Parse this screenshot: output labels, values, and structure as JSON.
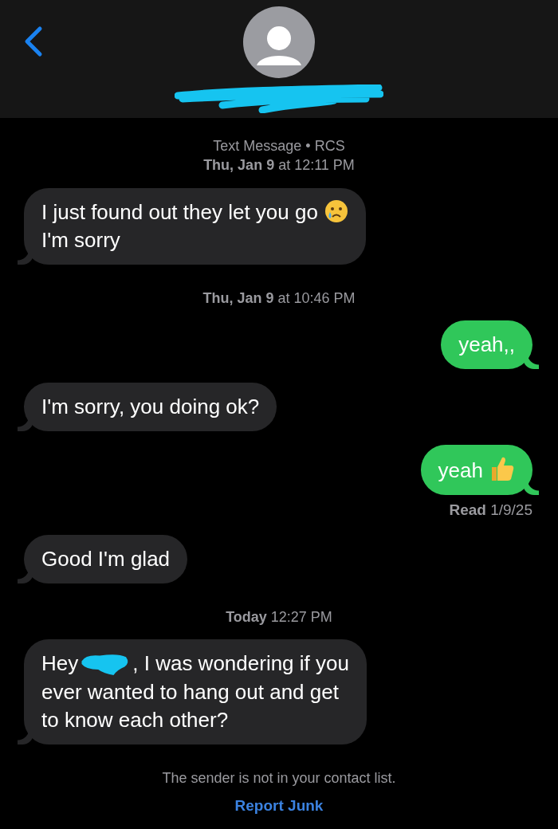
{
  "header": {
    "back": true,
    "contact_redacted": true
  },
  "thread": [
    {
      "kind": "meta",
      "service": "Text Message • RCS",
      "time": "**Thu, Jan 9** at 12:11 PM"
    },
    {
      "kind": "message",
      "outgoing": false,
      "parts": [
        {
          "kind": "text",
          "text": "I just found out they let you go"
        },
        {
          "kind": "crying-face"
        },
        {
          "kind": "linebreak"
        },
        {
          "kind": "text",
          "text": "I'm sorry"
        }
      ]
    },
    {
      "kind": "timestamp",
      "time": "**Thu, Jan 9** at 10:46 PM"
    },
    {
      "kind": "message",
      "outgoing": true,
      "parts": [
        {
          "kind": "text",
          "text": "yeah,,"
        }
      ]
    },
    {
      "kind": "message",
      "outgoing": false,
      "parts": [
        {
          "kind": "text",
          "text": "I'm sorry, you doing ok?"
        }
      ]
    },
    {
      "kind": "message",
      "outgoing": true,
      "parts": [
        {
          "kind": "text",
          "text": "yeah"
        },
        {
          "kind": "thumbs-up"
        }
      ]
    },
    {
      "kind": "receipt",
      "text": "**Read** 1/9/25"
    },
    {
      "kind": "message",
      "outgoing": false,
      "parts": [
        {
          "kind": "text",
          "text": "Good I'm glad"
        }
      ]
    },
    {
      "kind": "timestamp",
      "time": "**Today** 12:27 PM"
    },
    {
      "kind": "message",
      "outgoing": false,
      "parts": [
        {
          "kind": "text",
          "text": "Hey"
        },
        {
          "kind": "scribble"
        },
        {
          "kind": "text",
          "text": ", I was wondering if you"
        },
        {
          "kind": "linebreak"
        },
        {
          "kind": "text",
          "text": "ever wanted to hang out and get"
        },
        {
          "kind": "linebreak"
        },
        {
          "kind": "text",
          "text": "to know each other?"
        }
      ]
    },
    {
      "kind": "notice",
      "text": "The sender is not in your contact list."
    },
    {
      "kind": "link",
      "text": "Report Junk"
    }
  ]
}
